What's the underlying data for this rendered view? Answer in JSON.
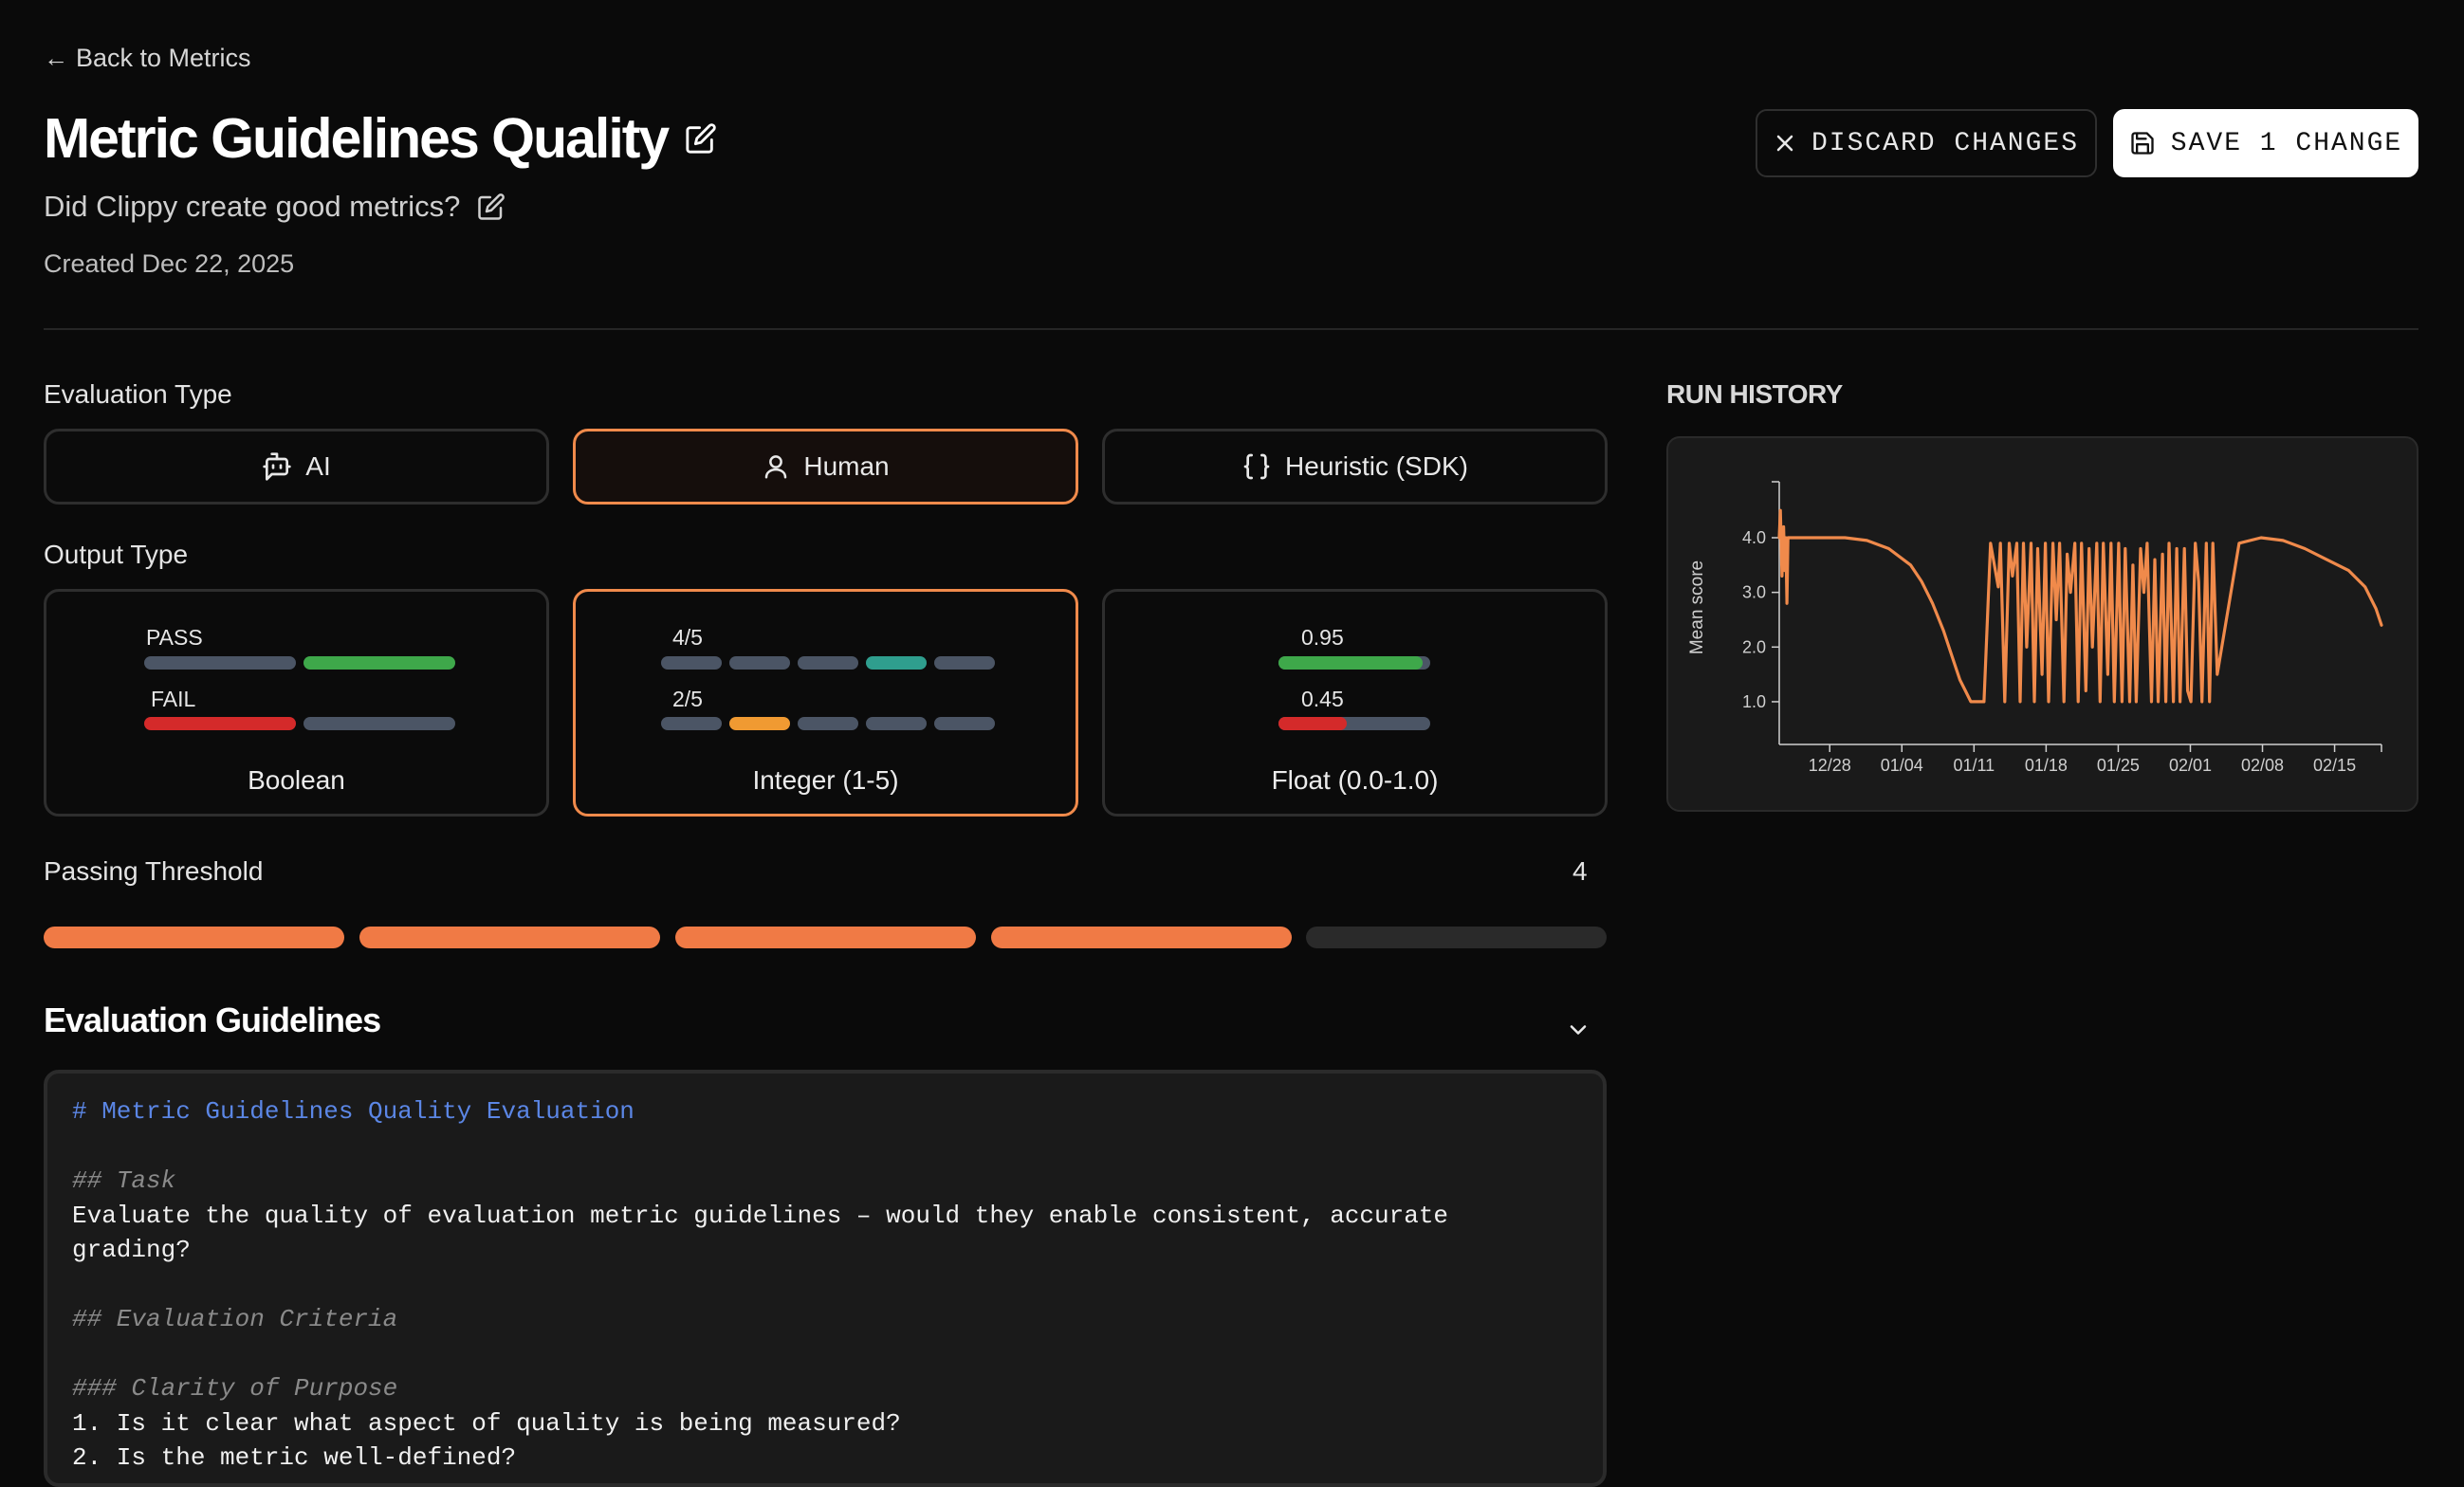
{
  "nav": {
    "back_label": "Back to Metrics"
  },
  "header": {
    "title": "Metric Guidelines Quality",
    "subtitle": "Did Clippy create good metrics?",
    "created": "Created Dec 22, 2025"
  },
  "actions": {
    "discard_label": "DISCARD CHANGES",
    "save_label": "SAVE 1 CHANGE"
  },
  "evaluation_type": {
    "label": "Evaluation Type",
    "options": [
      {
        "label": "AI",
        "icon": "bot-icon"
      },
      {
        "label": "Human",
        "icon": "user-icon"
      },
      {
        "label": "Heuristic (SDK)",
        "icon": "braces-icon"
      }
    ],
    "selected": "Human"
  },
  "output_type": {
    "label": "Output Type",
    "options": [
      {
        "name": "Boolean",
        "ex1": "PASS",
        "ex2": "FAIL"
      },
      {
        "name": "Integer (1-5)",
        "ex1": "4/5",
        "ex2": "2/5"
      },
      {
        "name": "Float (0.0-1.0)",
        "ex1": "0.95",
        "ex2": "0.45"
      }
    ],
    "selected": "Integer (1-5)"
  },
  "threshold": {
    "label": "Passing Threshold",
    "value": "4",
    "segments": 5,
    "filled": 4
  },
  "guidelines": {
    "title": "Evaluation Guidelines",
    "lines": [
      {
        "text": "# Metric Guidelines Quality Evaluation",
        "kind": "h1"
      },
      {
        "text": "",
        "kind": "txt"
      },
      {
        "text": "## Task",
        "kind": "h2"
      },
      {
        "text": "Evaluate the quality of evaluation metric guidelines – would they enable consistent, accurate grading?",
        "kind": "txt"
      },
      {
        "text": "",
        "kind": "txt"
      },
      {
        "text": "## Evaluation Criteria",
        "kind": "h2"
      },
      {
        "text": "",
        "kind": "txt"
      },
      {
        "text": "### Clarity of Purpose",
        "kind": "h2"
      },
      {
        "text": "1. Is it clear what aspect of quality is being measured?",
        "kind": "txt"
      },
      {
        "text": "2. Is the metric well-defined?",
        "kind": "txt"
      }
    ]
  },
  "run_history": {
    "title": "RUN HISTORY",
    "colors": {
      "line": "#f08a4b",
      "axis": "#cfcfcf"
    },
    "chart_data": {
      "type": "line",
      "ylabel": "Mean score",
      "yticks": [
        "1.0",
        "2.0",
        "3.0",
        "4.0"
      ],
      "ylim": [
        0.6,
        4.85
      ],
      "xticks": [
        "12/28",
        "01/04",
        "01/11",
        "01/18",
        "01/25",
        "02/01",
        "02/08",
        "02/15"
      ],
      "xlim": [
        0,
        55
      ],
      "series": [
        {
          "x": [
            0,
            0.1,
            0.25,
            0.4,
            0.5,
            0.6,
            0.7,
            0.8,
            1,
            2,
            4,
            6,
            8,
            10,
            12,
            13,
            14,
            15,
            16,
            16.5,
            17,
            17.5,
            18,
            18.7,
            19.3,
            20,
            20.2,
            20.6,
            21,
            21.3,
            21.7,
            22,
            22.3,
            22.6,
            23,
            23.3,
            23.6,
            24,
            24.3,
            24.6,
            25,
            25.3,
            25.6,
            26,
            26.3,
            26.6,
            27,
            27.3,
            27.6,
            28,
            28.3,
            28.6,
            29,
            29.3,
            29.6,
            30,
            30.3,
            30.6,
            31,
            31.3,
            31.6,
            32,
            32.3,
            32.6,
            33,
            33.3,
            33.6,
            34,
            34.3,
            34.6,
            35,
            35.3,
            35.6,
            36,
            36.3,
            36.6,
            37,
            37.3,
            37.6,
            38,
            38.3,
            38.6,
            39,
            39.3,
            39.6,
            40,
            42,
            44,
            46,
            48,
            50,
            52,
            53.5,
            54.5,
            55
          ],
          "y": [
            4.0,
            4.5,
            3.3,
            4.2,
            3.4,
            4.0,
            2.8,
            4.0,
            4.0,
            4.0,
            4.0,
            4.0,
            3.95,
            3.8,
            3.5,
            3.2,
            2.8,
            2.3,
            1.7,
            1.4,
            1.2,
            1.0,
            1.0,
            1.0,
            3.9,
            3.1,
            3.9,
            1.0,
            3.9,
            3.3,
            3.9,
            1.0,
            3.9,
            2.0,
            3.9,
            1.0,
            3.8,
            1.5,
            3.9,
            1.0,
            3.9,
            2.5,
            3.9,
            1.0,
            3.7,
            3.0,
            3.9,
            1.0,
            3.9,
            1.2,
            3.8,
            2.0,
            3.9,
            1.0,
            3.9,
            1.5,
            3.9,
            1.0,
            3.9,
            1.0,
            3.8,
            1.0,
            3.5,
            1.0,
            3.8,
            3.0,
            3.9,
            1.0,
            3.6,
            1.0,
            3.7,
            1.0,
            3.9,
            1.0,
            3.8,
            1.0,
            3.8,
            1.2,
            1.0,
            3.9,
            3.2,
            1.0,
            3.9,
            1.0,
            3.9,
            1.5,
            3.9,
            4.0,
            3.95,
            3.8,
            3.6,
            3.4,
            3.1,
            2.7,
            2.4,
            2.0,
            1.4
          ]
        }
      ]
    }
  }
}
